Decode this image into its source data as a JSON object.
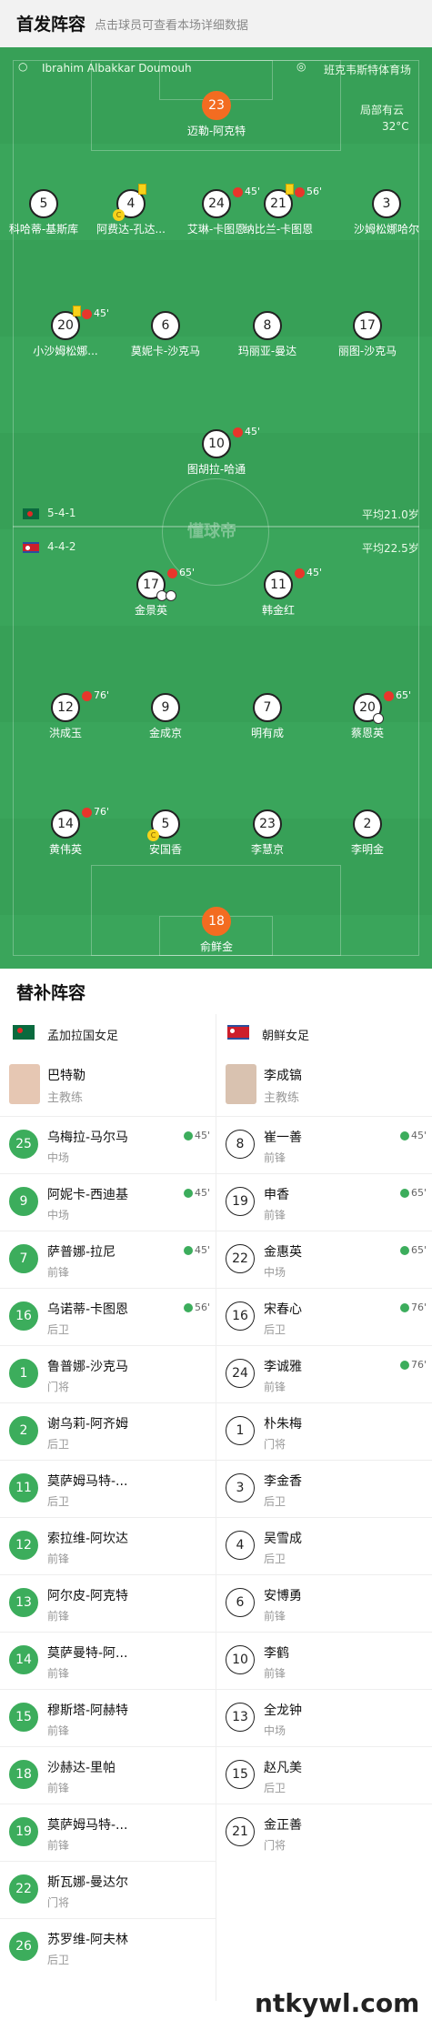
{
  "header": {
    "title": "首发阵容",
    "subtitle": "点击球员可查看本场详细数据"
  },
  "match": {
    "referee": "Ibrahim Albakkar Doumouh",
    "stadium": "班克韦斯特体育场",
    "weather": "局部有云",
    "temperature": "32°C"
  },
  "home": {
    "flag": "bangladesh-flag",
    "formation": "5-4-1",
    "avg_age": "平均21.0岁"
  },
  "away": {
    "flag": "north-korea-flag",
    "formation": "4-4-2",
    "avg_age": "平均22.5岁"
  },
  "watermark_center": "懂球帝",
  "bottom_watermark": "ntkywl.com",
  "home_starters": [
    {
      "num": "23",
      "name": "迈勒-阿克特",
      "gk": true
    },
    {
      "num": "5",
      "name": "科哈蒂-基斯库"
    },
    {
      "num": "4",
      "name": "阿费达-孔达...",
      "yellow": true,
      "captain": true
    },
    {
      "num": "24",
      "name": "艾琳-卡图恩",
      "sub": "45'"
    },
    {
      "num": "21",
      "name": "纳比兰-卡图恩",
      "sub": "56'",
      "yellow": true
    },
    {
      "num": "3",
      "name": "沙姆松娜哈尔"
    },
    {
      "num": "20",
      "name": "小沙姆松娜...",
      "sub": "45'",
      "yellow": true
    },
    {
      "num": "6",
      "name": "莫妮卡-沙克马"
    },
    {
      "num": "8",
      "name": "玛丽亚-曼达"
    },
    {
      "num": "17",
      "name": "丽图-沙克马"
    },
    {
      "num": "10",
      "name": "图胡拉-哈通",
      "sub": "45'"
    }
  ],
  "away_starters": [
    {
      "num": "17",
      "name": "金景英",
      "sub": "65'",
      "goals": 2
    },
    {
      "num": "11",
      "name": "韩金红",
      "sub": "45'"
    },
    {
      "num": "12",
      "name": "洪成玉",
      "sub": "76'"
    },
    {
      "num": "9",
      "name": "金成京"
    },
    {
      "num": "7",
      "name": "明有成"
    },
    {
      "num": "20",
      "name": "蔡恩英",
      "sub": "65'",
      "goals": 1
    },
    {
      "num": "14",
      "name": "黄伟英",
      "sub": "76'"
    },
    {
      "num": "5",
      "name": "安国香",
      "captain": true
    },
    {
      "num": "23",
      "name": "李慧京"
    },
    {
      "num": "2",
      "name": "李明金"
    },
    {
      "num": "18",
      "name": "俞鲜金",
      "gk": true
    }
  ],
  "subs": {
    "title": "替补阵容",
    "home_team": "孟加拉国女足",
    "away_team": "朝鲜女足",
    "home_coach": {
      "name": "巴特勒",
      "role": "主教练"
    },
    "away_coach": {
      "name": "李成镐",
      "role": "主教练"
    },
    "home": [
      {
        "num": "25",
        "name": "乌梅拉-马尔马",
        "pos": "中场",
        "ev": "45'"
      },
      {
        "num": "9",
        "name": "阿妮卡-西迪基",
        "pos": "中场",
        "ev": "45'"
      },
      {
        "num": "7",
        "name": "萨普娜-拉尼",
        "pos": "前锋",
        "ev": "45'"
      },
      {
        "num": "16",
        "name": "乌诺蒂-卡图恩",
        "pos": "后卫",
        "ev": "56'"
      },
      {
        "num": "1",
        "name": "鲁普娜-沙克马",
        "pos": "门将"
      },
      {
        "num": "2",
        "name": "谢乌莉-阿齐姆",
        "pos": "后卫"
      },
      {
        "num": "11",
        "name": "莫萨姆马特-...",
        "pos": "后卫"
      },
      {
        "num": "12",
        "name": "索拉维-阿坎达",
        "pos": "前锋"
      },
      {
        "num": "13",
        "name": "阿尔皮-阿克特",
        "pos": "前锋"
      },
      {
        "num": "14",
        "name": "莫萨曼特-阿...",
        "pos": "前锋"
      },
      {
        "num": "15",
        "name": "穆斯塔-阿赫特",
        "pos": "前锋"
      },
      {
        "num": "18",
        "name": "沙赫达-里帕",
        "pos": "前锋"
      },
      {
        "num": "19",
        "name": "莫萨姆马特-...",
        "pos": "前锋"
      },
      {
        "num": "22",
        "name": "斯瓦娜-曼达尔",
        "pos": "门将"
      },
      {
        "num": "26",
        "name": "苏罗维-阿夫林",
        "pos": "后卫"
      }
    ],
    "away": [
      {
        "num": "8",
        "name": "崔一善",
        "pos": "前锋",
        "ev": "45'"
      },
      {
        "num": "19",
        "name": "申香",
        "pos": "前锋",
        "ev": "65'"
      },
      {
        "num": "22",
        "name": "金惠英",
        "pos": "中场",
        "ev": "65'"
      },
      {
        "num": "16",
        "name": "宋春心",
        "pos": "后卫",
        "ev": "76'"
      },
      {
        "num": "24",
        "name": "李诚雅",
        "pos": "前锋",
        "ev": "76'"
      },
      {
        "num": "1",
        "name": "朴朱梅",
        "pos": "门将"
      },
      {
        "num": "3",
        "name": "李金香",
        "pos": "后卫"
      },
      {
        "num": "4",
        "name": "吴雪成",
        "pos": "后卫"
      },
      {
        "num": "6",
        "name": "安博勇",
        "pos": "前锋"
      },
      {
        "num": "10",
        "name": "李鹤",
        "pos": "前锋"
      },
      {
        "num": "13",
        "name": "全龙钟",
        "pos": "中场"
      },
      {
        "num": "15",
        "name": "赵凡美",
        "pos": "后卫"
      },
      {
        "num": "21",
        "name": "金正善",
        "pos": "门将"
      }
    ]
  }
}
